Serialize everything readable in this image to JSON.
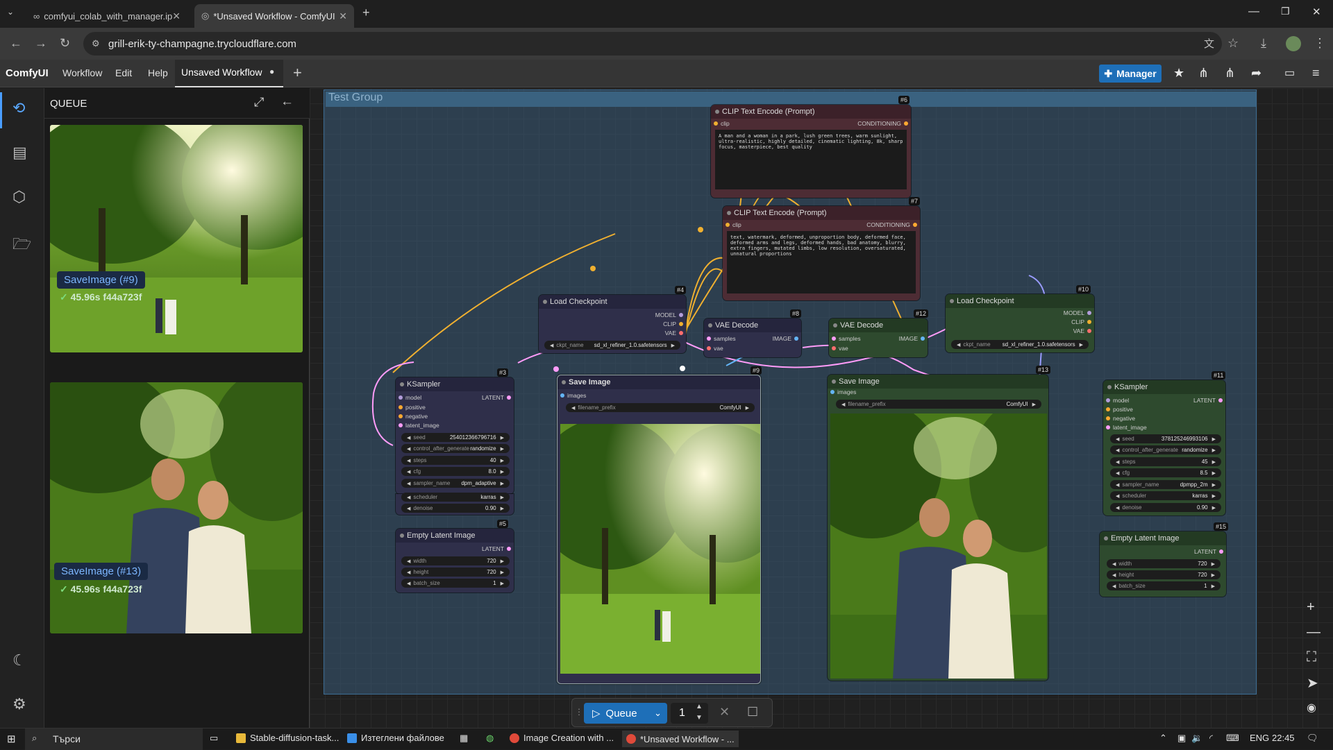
{
  "browser": {
    "tabs": [
      {
        "label": "comfyui_colab_with_manager.ip"
      },
      {
        "label": "*Unsaved Workflow - ComfyUI"
      }
    ],
    "url": "grill-erik-ty-champagne.trycloudflare.com"
  },
  "menubar": {
    "logo": "ComfyUI",
    "items": [
      "Workflow",
      "Edit",
      "Help"
    ],
    "workflow_tab": "Unsaved Workflow",
    "manager": "Manager"
  },
  "queue_panel": {
    "title": "QUEUE",
    "items": [
      {
        "label": "SaveImage (#9)",
        "time": "45.96s f44a723f"
      },
      {
        "label": "SaveImage (#13)",
        "time": "45.96s f44a723f"
      }
    ]
  },
  "canvas": {
    "group_title": "Test Group",
    "nodes": {
      "n6": {
        "id": "#6",
        "title": "CLIP Text Encode (Prompt)",
        "in": "clip",
        "out": "CONDITIONING",
        "text": "A man and a woman in a park, lush green trees, warm sunlight, ultra-realistic, highly detailed, cinematic lighting, 8k, sharp focus, masterpiece, best quality"
      },
      "n7": {
        "id": "#7",
        "title": "CLIP Text Encode (Prompt)",
        "in": "clip",
        "out": "CONDITIONING",
        "text": "text, watermark, deformed, unproportion body, deformed face, deformed arms and legs, deformed hands, bad anatomy, blurry, extra fingers, mutated limbs, low resolution, oversaturated, unnatural proportions"
      },
      "n4": {
        "id": "#4",
        "title": "Load Checkpoint",
        "outs": [
          "MODEL",
          "CLIP",
          "VAE"
        ],
        "ckpt_label": "ckpt_name",
        "ckpt": "sd_xl_refiner_1.0.safetensors"
      },
      "n8": {
        "id": "#8",
        "title": "VAE Decode",
        "ins": [
          "samples",
          "vae"
        ],
        "out": "IMAGE"
      },
      "n12": {
        "id": "#12",
        "title": "VAE Decode",
        "ins": [
          "samples",
          "vae"
        ],
        "out": "IMAGE"
      },
      "n10": {
        "id": "#10",
        "title": "Load Checkpoint",
        "outs": [
          "MODEL",
          "CLIP",
          "VAE"
        ],
        "ckpt_label": "ckpt_name",
        "ckpt": "sd_xl_refiner_1.0.safetensors"
      },
      "n3": {
        "id": "#3",
        "title": "KSampler",
        "ins": [
          "model",
          "positive",
          "negative",
          "latent_image"
        ],
        "out": "LATENT",
        "widgets": [
          {
            "label": "seed",
            "value": "254012366796716"
          },
          {
            "label": "control_after_generate",
            "value": "randomize"
          },
          {
            "label": "steps",
            "value": "40"
          },
          {
            "label": "cfg",
            "value": "8.0"
          },
          {
            "label": "sampler_name",
            "value": "dpm_adaptive"
          },
          {
            "label": "scheduler",
            "value": "karras"
          },
          {
            "label": "denoise",
            "value": "0.90"
          }
        ]
      },
      "n9": {
        "id": "#9",
        "title": "Save Image",
        "in": "images",
        "prefix_label": "filename_prefix",
        "prefix": "ComfyUI"
      },
      "n13": {
        "id": "#13",
        "title": "Save Image",
        "in": "images",
        "prefix_label": "filename_prefix",
        "prefix": "ComfyUI"
      },
      "n11": {
        "id": "#11",
        "title": "KSampler",
        "ins": [
          "model",
          "positive",
          "negative",
          "latent_image"
        ],
        "out": "LATENT",
        "widgets": [
          {
            "label": "seed",
            "value": "378125246993106"
          },
          {
            "label": "control_after_generate",
            "value": "randomize"
          },
          {
            "label": "steps",
            "value": "45"
          },
          {
            "label": "cfg",
            "value": "8.5"
          },
          {
            "label": "sampler_name",
            "value": "dpmpp_2m"
          },
          {
            "label": "scheduler",
            "value": "karras"
          },
          {
            "label": "denoise",
            "value": "0.90"
          }
        ]
      },
      "n5": {
        "id": "#5",
        "title": "Empty Latent Image",
        "out": "LATENT",
        "widgets": [
          {
            "label": "width",
            "value": "720"
          },
          {
            "label": "height",
            "value": "720"
          },
          {
            "label": "batch_size",
            "value": "1"
          }
        ]
      },
      "n15": {
        "id": "#15",
        "title": "Empty Latent Image",
        "out": "LATENT",
        "widgets": [
          {
            "label": "width",
            "value": "720"
          },
          {
            "label": "height",
            "value": "720"
          },
          {
            "label": "batch_size",
            "value": "1"
          }
        ]
      }
    }
  },
  "queue_bar": {
    "button": "Queue",
    "count": "1"
  },
  "taskbar": {
    "search": "Търси",
    "items": [
      "Stable-diffusion-task...",
      "Изтеглени файлове",
      "Image Creation with ...",
      "*Unsaved Workflow - ..."
    ],
    "lang": "ENG",
    "time": "22:45"
  },
  "colors": {
    "accent": "#1e6fb8",
    "group": "#3a6280",
    "clip_wire": "#f0b030",
    "latent_wire": "#ff9cf9"
  }
}
